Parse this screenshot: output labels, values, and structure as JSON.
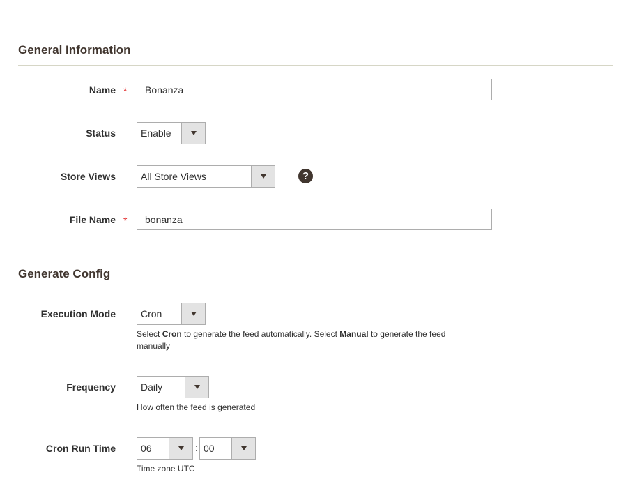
{
  "general": {
    "title": "General Information",
    "name_label": "Name",
    "name_value": "Bonanza",
    "status_label": "Status",
    "status_value": "Enable",
    "store_views_label": "Store Views",
    "store_views_value": "All Store Views",
    "help_glyph": "?",
    "file_name_label": "File Name",
    "file_name_value": "bonanza",
    "required_mark": "*"
  },
  "generate": {
    "title": "Generate Config",
    "execution_mode_label": "Execution Mode",
    "execution_mode_value": "Cron",
    "execution_note": {
      "p1": "Select ",
      "b1": "Cron",
      "p2": " to generate the feed automatically. Select ",
      "b2": "Manual",
      "p3": " to generate the feed",
      "p4": "manually"
    },
    "frequency_label": "Frequency",
    "frequency_value": "Daily",
    "frequency_note": "How often the feed is generated",
    "cron_run_time_label": "Cron Run Time",
    "hour_value": "06",
    "minute_value": "00",
    "time_separator": ":",
    "time_note": "Time zone UTC"
  },
  "colors": {
    "required": "#e22626",
    "heading": "#41362f",
    "select_button": "#e3e3e3"
  },
  "icons": {
    "help": "question-circle-icon",
    "dropdown": "chevron-down-icon"
  }
}
